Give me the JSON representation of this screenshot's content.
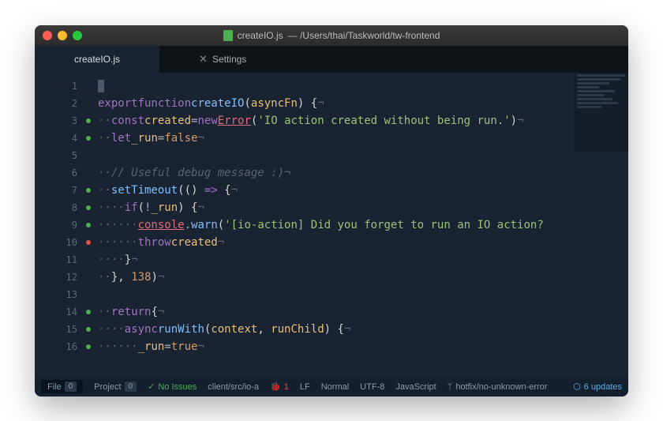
{
  "window": {
    "title_file": "createIO.js",
    "title_path": "— /Users/thai/Taskworld/tw-frontend"
  },
  "tabs": [
    {
      "label": "createIO.js",
      "active": true
    },
    {
      "label": "Settings",
      "active": false
    }
  ],
  "lines": [
    {
      "n": "1",
      "dot": "",
      "html": "<span class='cursor'></span>"
    },
    {
      "n": "2",
      "dot": "",
      "html": "<span class='k'>export</span> <span class='k'>function</span> <span class='fn'>createIO</span> <span class='b'>(</span><span class='id'>asyncFn</span><span class='b'>) {</span><span class='cm'>¬</span>"
    },
    {
      "n": "3",
      "dot": "g",
      "html": "<span class='cm'>··</span><span class='k'>const</span> <span class='id'>created</span> <span class='w'>=</span> <span class='k'>new</span> <span class='obj'>Error</span><span class='b'>(</span><span class='str'>'IO action created without being run.'</span><span class='b'>)</span><span class='cm'>¬</span>"
    },
    {
      "n": "4",
      "dot": "g",
      "html": "<span class='cm'>··</span><span class='k'>let</span> <span class='id'>_run</span> <span class='w'>=</span> <span class='num'>false</span><span class='cm'>¬</span>"
    },
    {
      "n": "5",
      "dot": "",
      "html": ""
    },
    {
      "n": "6",
      "dot": "",
      "html": "<span class='cm'>··// Useful debug message :)¬</span>"
    },
    {
      "n": "7",
      "dot": "g",
      "html": "<span class='cm'>··</span><span class='fn'>setTimeout</span><span class='b'>(() </span><span class='k'>=></span><span class='b'> {</span><span class='cm'>¬</span>"
    },
    {
      "n": "8",
      "dot": "g",
      "html": "<span class='cm'>····</span><span class='k'>if</span> <span class='b'>(</span><span class='w'>!</span><span class='id'>_run</span><span class='b'>) {</span><span class='cm'>¬</span>"
    },
    {
      "n": "9",
      "dot": "g",
      "html": "<span class='cm'>······</span><span class='obj'>console</span><span class='w'>.</span><span class='prop'>warn</span><span class='b'>(</span><span class='str'>'[io-action] Did you forget to run an IO action?</span>"
    },
    {
      "n": "10",
      "dot": "r",
      "html": "<span class='cm'>······</span><span class='k'>throw</span> <span class='id'>created</span><span class='cm'>¬</span>"
    },
    {
      "n": "11",
      "dot": "",
      "html": "<span class='cm'>····</span><span class='b'>}</span><span class='cm'>¬</span>"
    },
    {
      "n": "12",
      "dot": "",
      "html": "<span class='cm'>··</span><span class='b'>}, </span><span class='num'>138</span><span class='b'>)</span><span class='cm'>¬</span>"
    },
    {
      "n": "13",
      "dot": "",
      "html": ""
    },
    {
      "n": "14",
      "dot": "g",
      "html": "<span class='cm'>··</span><span class='k'>return</span> <span class='b'>{</span><span class='cm'>¬</span>"
    },
    {
      "n": "15",
      "dot": "g",
      "html": "<span class='cm'>····</span><span class='k'>async</span> <span class='fn'>runWith</span> <span class='b'>(</span><span class='id'>context</span><span class='b'>, </span><span class='id'>runChild</span><span class='b'>) {</span><span class='cm'>¬</span>"
    },
    {
      "n": "16",
      "dot": "g",
      "html": "<span class='cm'>······</span><span class='id'>_run</span> <span class='w'>=</span> <span class='num'>true</span><span class='cm'>¬</span>"
    }
  ],
  "status": {
    "file": "File",
    "file_count": "0",
    "project": "Project",
    "project_count": "0",
    "issues": "No Issues",
    "path": "client/src/io-a",
    "errors": "1",
    "lineending": "LF",
    "mode": "Normal",
    "encoding": "UTF-8",
    "language": "JavaScript",
    "branch": "hotfix/no-unknown-error",
    "updates": "6 updates"
  }
}
